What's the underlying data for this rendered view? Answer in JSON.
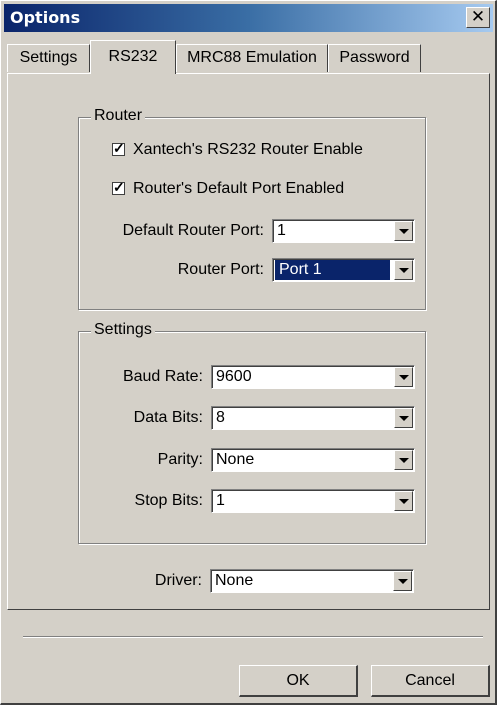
{
  "window": {
    "title": "Options",
    "close_symbol": "✕"
  },
  "tabs": [
    {
      "label": "Settings",
      "active": false
    },
    {
      "label": "RS232",
      "active": true
    },
    {
      "label": "MRC88 Emulation",
      "active": false
    },
    {
      "label": "Password",
      "active": false
    }
  ],
  "router": {
    "legend": "Router",
    "enable": {
      "label": "Xantech's RS232 Router Enable",
      "checked": true
    },
    "default_port_enabled": {
      "label": "Router's Default Port Enabled",
      "checked": true
    },
    "default_router_port": {
      "label": "Default Router Port:",
      "value": "1"
    },
    "router_port": {
      "label": "Router Port:",
      "value": "Port 1"
    }
  },
  "settings": {
    "legend": "Settings",
    "baud_rate": {
      "label": "Baud Rate:",
      "value": "9600"
    },
    "data_bits": {
      "label": "Data Bits:",
      "value": "8"
    },
    "parity": {
      "label": "Parity:",
      "value": "None"
    },
    "stop_bits": {
      "label": "Stop Bits:",
      "value": "1"
    }
  },
  "driver": {
    "label": "Driver:",
    "value": "None"
  },
  "buttons": {
    "ok": "OK",
    "cancel": "Cancel"
  },
  "check_mark": "✓"
}
